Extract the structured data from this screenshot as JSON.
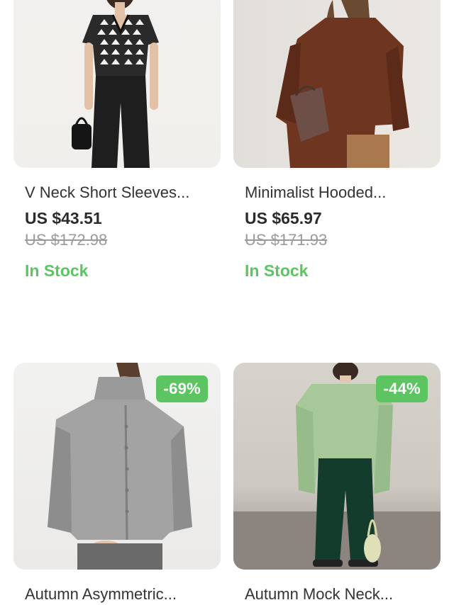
{
  "colors": {
    "accent_green": "#5cc561",
    "price_text": "#2b2b2b",
    "strike_text": "#9a9a9a"
  },
  "products": [
    {
      "title": "V Neck Short Sleeves...",
      "price": "US $43.51",
      "original_price": "US $172.98",
      "stock": "In Stock",
      "badge": ""
    },
    {
      "title": "Minimalist Hooded...",
      "price": "US $65.97",
      "original_price": "US $171.93",
      "stock": "In Stock",
      "badge": ""
    },
    {
      "title": "Autumn Asymmetric...",
      "price": "",
      "original_price": "",
      "stock": "",
      "badge": "-69%"
    },
    {
      "title": "Autumn Mock Neck...",
      "price": "",
      "original_price": "",
      "stock": "",
      "badge": "-44%"
    }
  ]
}
